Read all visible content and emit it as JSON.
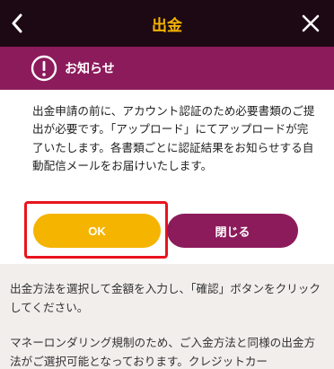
{
  "header": {
    "title": "出金"
  },
  "dialog": {
    "title": "お知らせ",
    "message": "出金申請の前に、アカウント認証のため必要書類のご提出が必要です。「アップロード」にてアップロードが完了いたします。各書類ごとに認証結果をお知らせする自動配信メールをお届けいたします。",
    "ok_label": "OK",
    "close_label": "閉じる"
  },
  "content": {
    "paragraph1": "出金方法を選択して金額を入力し、「確認」ボタンをクリックしてください。",
    "paragraph2": "マネーロンダリング規制のため、ご入金方法と同様の出金方法がご選択可能となっております。クレジットカー"
  },
  "colors": {
    "topbar": "#1c0913",
    "accent": "#f5b400",
    "brand": "#8c1b5b",
    "highlight": "#e8141e"
  }
}
